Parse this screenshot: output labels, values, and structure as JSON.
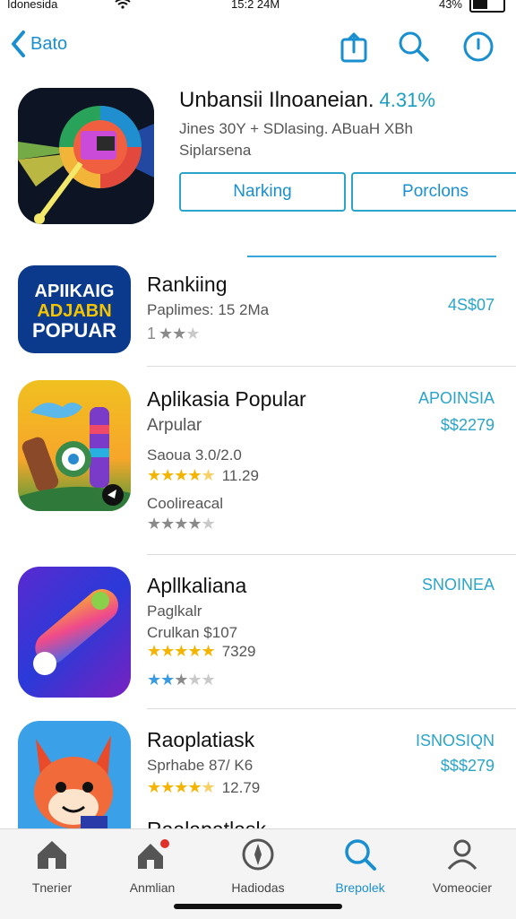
{
  "status_bar": {
    "carrier": "Idonesida",
    "time": "15:2 24M",
    "battery": "43%"
  },
  "nav": {
    "back_label": "Bato"
  },
  "featured": {
    "title": "Unbansii Ilnoaneian.",
    "rating": "4.31%",
    "subtitle_line1": "Jines 30Y + SDlasing. ABuaH XBh",
    "subtitle_line2": "Siplarsena",
    "button1_label": "Narking",
    "button2_label": "Porclons"
  },
  "apps": [
    {
      "icon_text": [
        "APIIKAIG",
        "ADJABN",
        "POPUAR"
      ],
      "name": "Rankiing",
      "line1": "Paplimes: 15 2Ma",
      "price_line1": "4S$07",
      "rating_stars": 1
    },
    {
      "name": "Aplikasia Popular",
      "line1": "Arpular",
      "line2": "Saoua 3.0/2.0",
      "rating_count": "11.29",
      "line3": "Coolireacal",
      "price_line1": "APOINSIA",
      "price_line2": "$$2279",
      "rating_stars": 4.5
    },
    {
      "name": "Apllkaliana",
      "line1": "Paglkalr",
      "line2": "Crulkan $107",
      "rating_count": "7329",
      "price_line1": "SNOINEA",
      "rating_stars": 5
    },
    {
      "name": "Raoplatiask",
      "line1": "Sprhabe 87/ K6",
      "rating_count": "12.79",
      "price_line1": "ISNOSIQN",
      "price_line2": "$$$279",
      "rating_stars": 4.5,
      "next_peek": "Raalapatlask"
    }
  ],
  "tabs": [
    {
      "label": "Tnerier",
      "icon": "home-icon"
    },
    {
      "label": "Anmlian",
      "icon": "home-notify-icon"
    },
    {
      "label": "Hadiodas",
      "icon": "compass-icon"
    },
    {
      "label": "Brepolek",
      "icon": "search-icon",
      "active": true
    },
    {
      "label": "Vomeocier",
      "icon": "person-icon"
    }
  ],
  "colors": {
    "accent": "#1a8fd0",
    "price": "#2aa4c8",
    "star": "#f5b400"
  }
}
